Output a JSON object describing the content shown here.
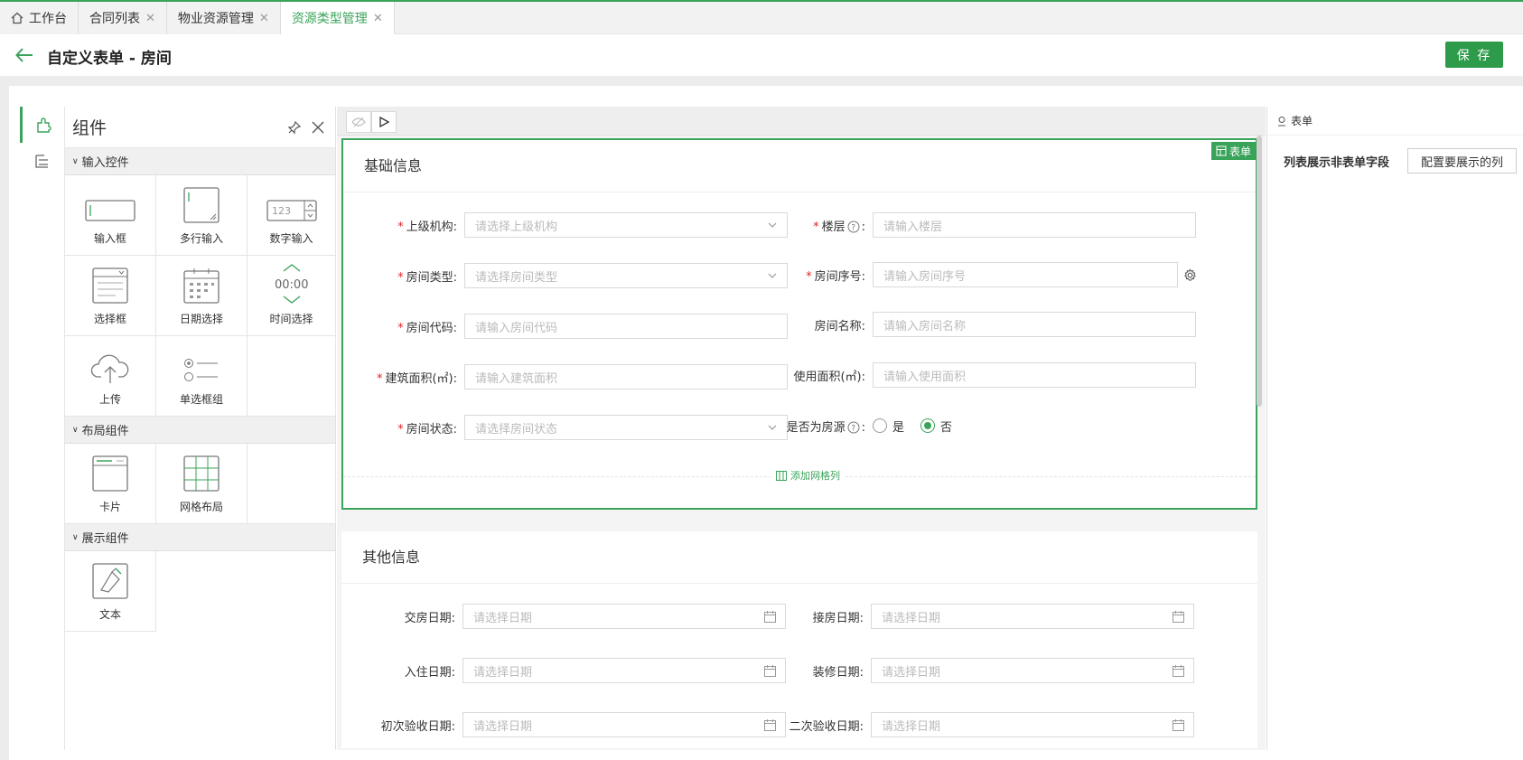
{
  "tabs": [
    {
      "label": "工作台",
      "icon": "home-icon",
      "closable": false,
      "active": false
    },
    {
      "label": "合同列表",
      "closable": true,
      "active": false
    },
    {
      "label": "物业资源管理",
      "closable": true,
      "active": false
    },
    {
      "label": "资源类型管理",
      "closable": true,
      "active": true
    }
  ],
  "header": {
    "title": "自定义表单 - 房间",
    "save_label": "保 存"
  },
  "colors": {
    "accent": "#3aa35a",
    "save": "#2e9b4b",
    "required": "#e02424"
  },
  "panel": {
    "title": "组件",
    "groups": [
      {
        "label": "输入控件",
        "items": [
          "输入框",
          "多行输入",
          "数字输入",
          "选择框",
          "日期选择",
          "时间选择",
          "上传",
          "单选框组"
        ]
      },
      {
        "label": "布局组件",
        "items": [
          "卡片",
          "网格布局"
        ]
      },
      {
        "label": "展示组件",
        "items": [
          "文本"
        ]
      }
    ],
    "number_sample": "123",
    "time_sample": "00:00"
  },
  "canvas": {
    "form_badge": "表单",
    "add_grid_col": "添加网格列",
    "section1": {
      "title": "基础信息",
      "fields": {
        "parent_org": {
          "label": "上级机构:",
          "placeholder": "请选择上级机构",
          "required": true
        },
        "floor": {
          "label": "楼层",
          "colon": ":",
          "placeholder": "请输入楼层",
          "required": true
        },
        "room_type": {
          "label": "房间类型:",
          "placeholder": "请选择房间类型",
          "required": true
        },
        "room_seq": {
          "label": "房间序号:",
          "placeholder": "请输入房间序号",
          "required": true
        },
        "room_code": {
          "label": "房间代码:",
          "placeholder": "请输入房间代码",
          "required": true
        },
        "room_name": {
          "label": "房间名称:",
          "placeholder": "请输入房间名称",
          "required": false
        },
        "build_area": {
          "label": "建筑面积(㎡):",
          "placeholder": "请输入建筑面积",
          "required": true
        },
        "use_area": {
          "label": "使用面积(㎡):",
          "placeholder": "请输入使用面积",
          "required": false
        },
        "room_status": {
          "label": "房间状态:",
          "placeholder": "请选择房间状态",
          "required": true
        },
        "is_housing": {
          "label": "是否为房源",
          "colon": ":",
          "options": [
            "是",
            "否"
          ],
          "selected": "否"
        }
      }
    },
    "section2": {
      "title": "其他信息",
      "fields": {
        "handover_date": {
          "label": "交房日期:",
          "placeholder": "请选择日期"
        },
        "receive_date": {
          "label": "接房日期:",
          "placeholder": "请选择日期"
        },
        "checkin_date": {
          "label": "入住日期:",
          "placeholder": "请选择日期"
        },
        "decor_date": {
          "label": "装修日期:",
          "placeholder": "请选择日期"
        },
        "first_insp_date": {
          "label": "初次验收日期:",
          "placeholder": "请选择日期"
        },
        "second_insp_date": {
          "label": "二次验收日期:",
          "placeholder": "请选择日期"
        }
      }
    }
  },
  "props": {
    "head": "表单",
    "row_label": "列表展示非表单字段",
    "row_button": "配置要展示的列"
  }
}
